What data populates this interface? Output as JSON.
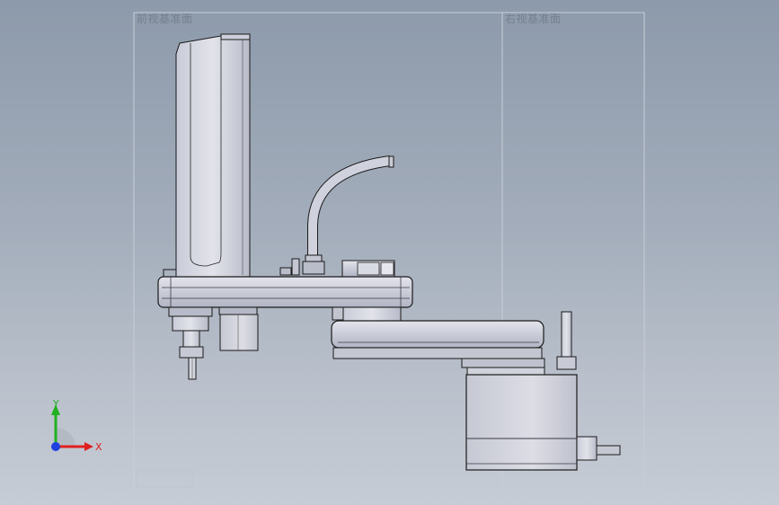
{
  "viewport": {
    "front_plane_label": "前视基准面",
    "right_plane_label": "右视基准面"
  },
  "triad": {
    "x_label": "X",
    "y_label": "Y",
    "x_color": "#e02020",
    "y_color": "#20b020",
    "z_color": "#2040e0"
  },
  "model": {
    "body_color": "#d4d6e0",
    "body_dark": "#a7aab8",
    "edge_color": "#1a1a1a"
  }
}
